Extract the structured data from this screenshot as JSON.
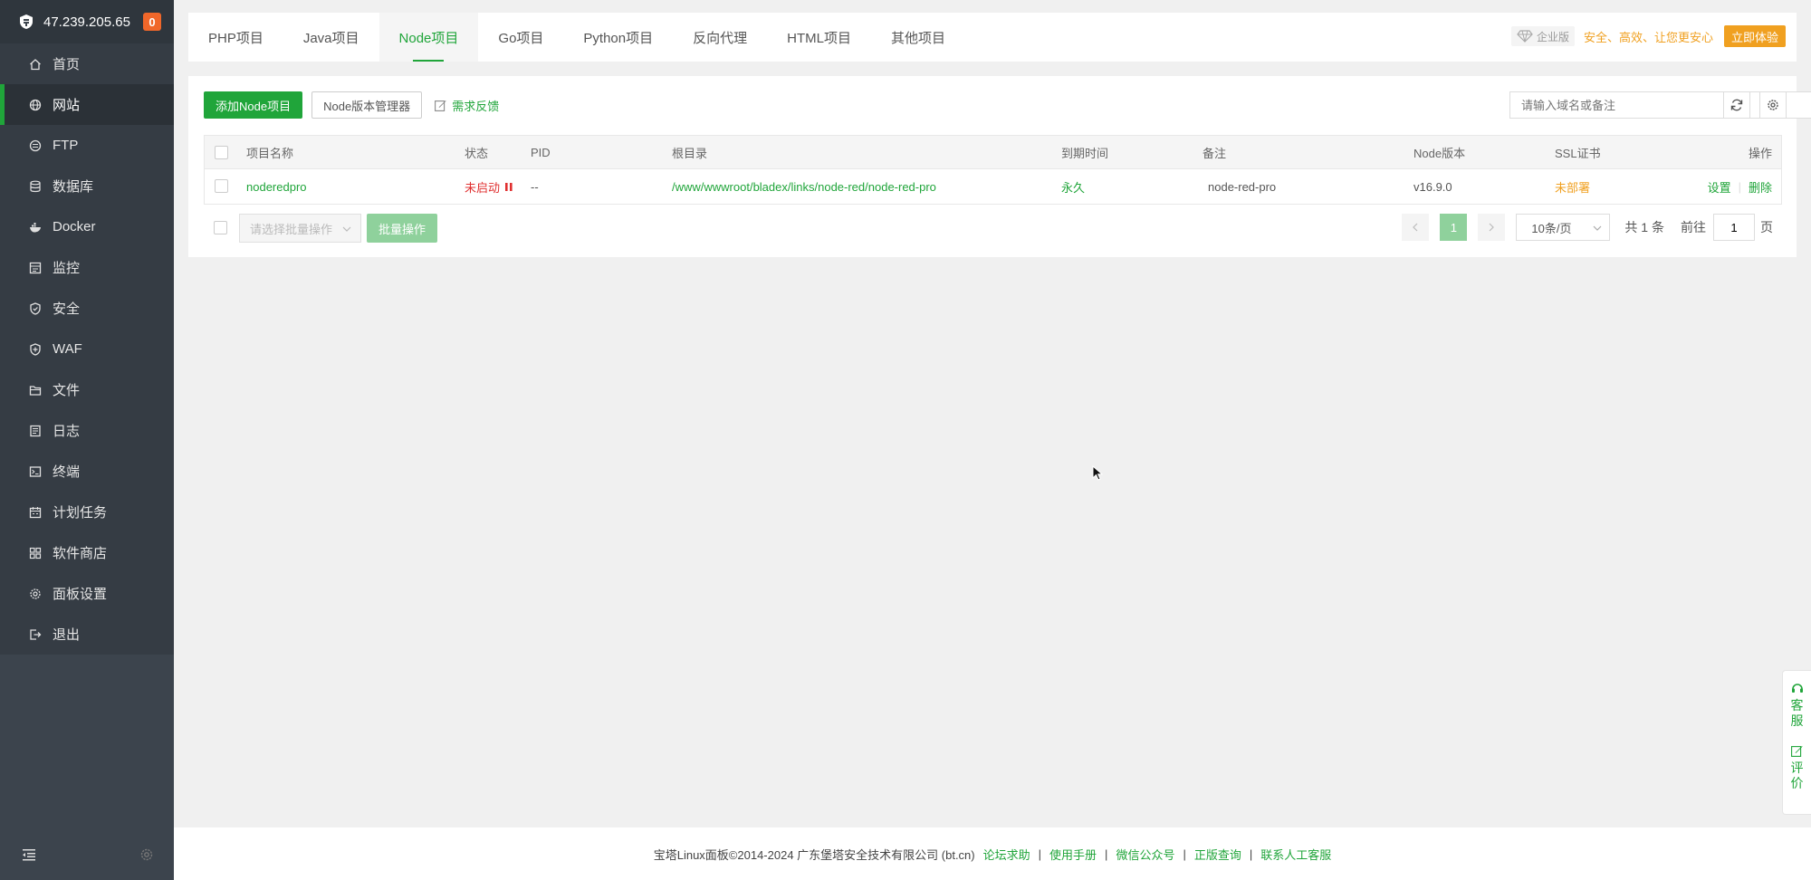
{
  "sidebar": {
    "ip": "47.239.205.65",
    "badge": "0",
    "items": [
      {
        "label": "首页",
        "icon": "home-icon"
      },
      {
        "label": "网站",
        "icon": "globe-icon"
      },
      {
        "label": "FTP",
        "icon": "ftp-icon"
      },
      {
        "label": "数据库",
        "icon": "database-icon"
      },
      {
        "label": "Docker",
        "icon": "docker-icon"
      },
      {
        "label": "监控",
        "icon": "monitor-icon"
      },
      {
        "label": "安全",
        "icon": "shield-icon"
      },
      {
        "label": "WAF",
        "icon": "waf-icon"
      },
      {
        "label": "文件",
        "icon": "folder-icon"
      },
      {
        "label": "日志",
        "icon": "log-icon"
      },
      {
        "label": "终端",
        "icon": "terminal-icon"
      },
      {
        "label": "计划任务",
        "icon": "calendar-icon"
      },
      {
        "label": "软件商店",
        "icon": "grid-icon"
      },
      {
        "label": "面板设置",
        "icon": "gear-icon"
      },
      {
        "label": "退出",
        "icon": "logout-icon"
      }
    ],
    "active_index": 1
  },
  "tabs": [
    "PHP项目",
    "Java项目",
    "Node项目",
    "Go项目",
    "Python项目",
    "反向代理",
    "HTML项目",
    "其他项目"
  ],
  "active_tab": 2,
  "enterprise": {
    "tag": "企业版",
    "slogan": "安全、高效、让您更安心",
    "button": "立即体验"
  },
  "toolbar": {
    "add_button": "添加Node项目",
    "version_manager": "Node版本管理器",
    "feedback": "需求反馈",
    "search_placeholder": "请输入域名或备注"
  },
  "table": {
    "headers": [
      "项目名称",
      "状态",
      "PID",
      "根目录",
      "到期时间",
      "备注",
      "Node版本",
      "SSL证书",
      "操作"
    ],
    "rows": [
      {
        "name": "noderedpro",
        "status": "未启动",
        "pid": "--",
        "root": "/www/wwwroot/bladex/links/node-red/node-red-pro",
        "expire": "永久",
        "remark": "node-red-pro",
        "node_version": "v16.9.0",
        "ssl": "未部署",
        "action_settings": "设置",
        "action_delete": "删除"
      }
    ]
  },
  "batch": {
    "select_placeholder": "请选择批量操作",
    "button": "批量操作"
  },
  "pagination": {
    "current_page": "1",
    "page_size": "10条/页",
    "total": "共 1 条",
    "goto_label": "前往",
    "goto_value": "1",
    "page_suffix": "页"
  },
  "footer": {
    "copyright": "宝塔Linux面板©2014-2024 广东堡塔安全技术有限公司 (bt.cn)",
    "links": [
      "论坛求助",
      "使用手册",
      "微信公众号",
      "正版查询",
      "联系人工客服"
    ]
  },
  "float": {
    "service": [
      "客",
      "服"
    ],
    "review": [
      "评",
      "价"
    ]
  },
  "colors": {
    "accent": "#20a53a",
    "sidebar": "#3c444d",
    "warning": "#f0a020",
    "danger": "#e03030"
  }
}
